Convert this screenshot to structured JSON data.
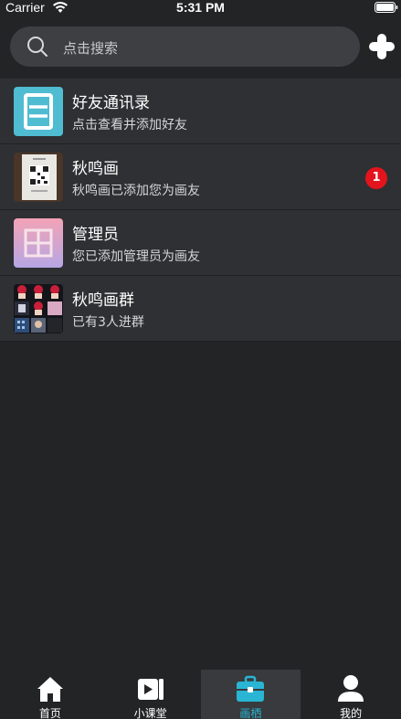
{
  "status_bar": {
    "carrier": "Carrier",
    "time": "5:31 PM"
  },
  "search": {
    "placeholder": "点击搜索"
  },
  "contacts": [
    {
      "title": "好友通讯录",
      "subtitle": "点击查看并添加好友",
      "avatar": "address-book-icon",
      "badge": ""
    },
    {
      "title": "秋鸣画",
      "subtitle": "秋鸣画已添加您为画友",
      "avatar": "qr-photo-avatar",
      "badge": "1"
    },
    {
      "title": "管理员",
      "subtitle": "您已添加管理员为画友",
      "avatar": "admin-avatar",
      "badge": ""
    },
    {
      "title": "秋鸣画群",
      "subtitle": "已有3人进群",
      "avatar": "group-collage-avatar",
      "badge": ""
    }
  ],
  "tabs": [
    {
      "label": "首页",
      "icon": "home-icon",
      "active": false
    },
    {
      "label": "小课堂",
      "icon": "video-icon",
      "active": false
    },
    {
      "label": "画栖",
      "icon": "briefcase-icon",
      "active": true
    },
    {
      "label": "我的",
      "icon": "user-icon",
      "active": false
    }
  ],
  "colors": {
    "accent": "#29b5d3",
    "badge": "#e3141d",
    "background": "#232426",
    "row": "#2e3033"
  }
}
